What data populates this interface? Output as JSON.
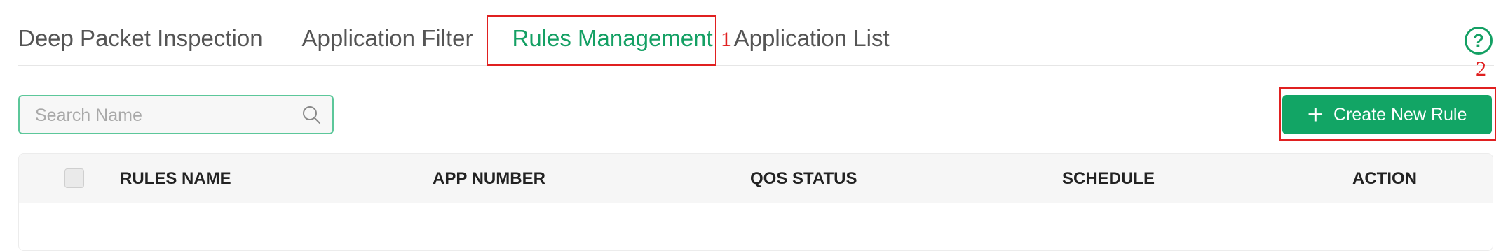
{
  "tabs": [
    {
      "label": "Deep Packet Inspection",
      "active": false
    },
    {
      "label": "Application Filter",
      "active": false
    },
    {
      "label": "Rules Management",
      "active": true
    },
    {
      "label": "Application List",
      "active": false
    }
  ],
  "annotations": {
    "first": "1",
    "second": "2"
  },
  "search": {
    "placeholder": "Search Name",
    "value": ""
  },
  "create_button": {
    "label": "Create New Rule"
  },
  "table": {
    "columns": [
      "RULES NAME",
      "APP NUMBER",
      "QOS STATUS",
      "SCHEDULE",
      "ACTION"
    ],
    "rows": []
  },
  "colors": {
    "accent": "#14a064",
    "annotation": "#e02020"
  }
}
